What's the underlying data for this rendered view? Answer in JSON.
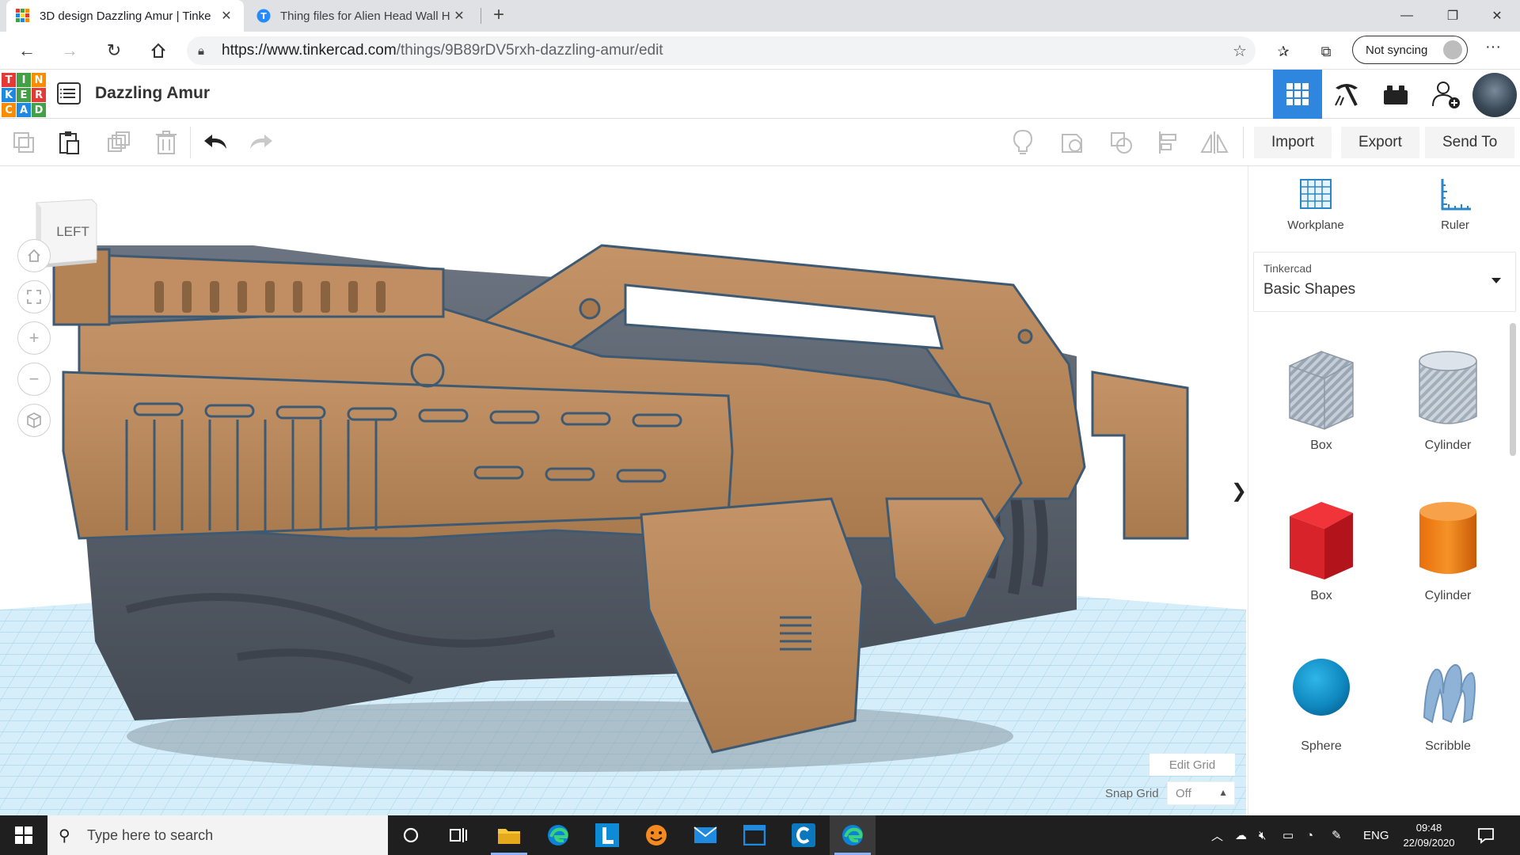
{
  "browser": {
    "tabs": [
      {
        "title": "3D design Dazzling Amur | Tinke",
        "active": true
      },
      {
        "title": "Thing files for Alien Head Wall H",
        "active": false
      }
    ],
    "url_host": "https://www.tinkercad.com",
    "url_path": "/things/9B89rDV5rxh-dazzling-amur/edit",
    "sync_label": "Not syncing"
  },
  "app": {
    "logo_letters": [
      "T",
      "I",
      "N",
      "K",
      "E",
      "R",
      "C",
      "A",
      "D"
    ],
    "design_name": "Dazzling Amur"
  },
  "toolbar": {
    "import_label": "Import",
    "export_label": "Export",
    "send_to_label": "Send To"
  },
  "viewport": {
    "viewcube_label": "LEFT",
    "edit_grid_label": "Edit Grid",
    "snap_grid_label": "Snap Grid",
    "snap_grid_value": "Off"
  },
  "panel": {
    "workplane_label": "Workplane",
    "ruler_label": "Ruler",
    "library_group": "Tinkercad",
    "library_name": "Basic Shapes",
    "shapes": [
      {
        "label": "Box"
      },
      {
        "label": "Cylinder"
      },
      {
        "label": "Box"
      },
      {
        "label": "Cylinder"
      },
      {
        "label": "Sphere"
      },
      {
        "label": "Scribble"
      }
    ]
  },
  "taskbar": {
    "search_placeholder": "Type here to search",
    "language": "ENG",
    "time": "09:48",
    "date": "22/09/2020"
  },
  "colors": {
    "accent": "#2e86de",
    "model_main": "#b98a5c",
    "model_rock": "#56606b",
    "grid": "#cde8f6"
  }
}
